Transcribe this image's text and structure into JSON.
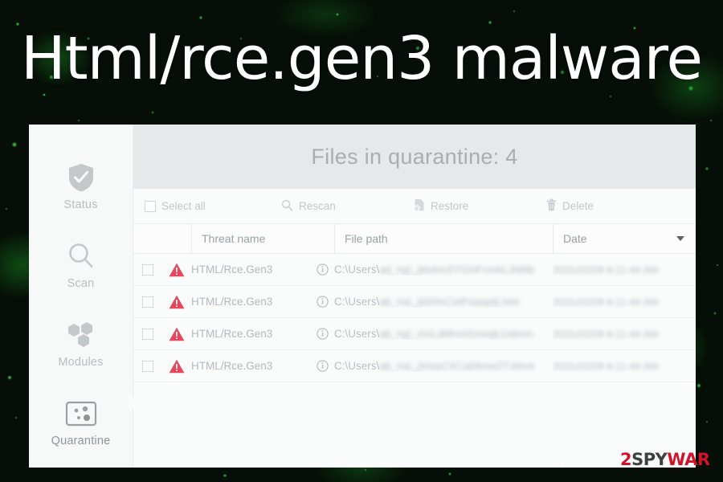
{
  "page": {
    "title": "Html/rce.gen3 malware"
  },
  "watermark": {
    "part1": "2",
    "part2": "SPY",
    "part3": "WAR"
  },
  "sidebar": {
    "items": [
      {
        "label": "Status",
        "icon": "shield-check-icon",
        "active": false
      },
      {
        "label": "Scan",
        "icon": "magnifier-icon",
        "active": false
      },
      {
        "label": "Modules",
        "icon": "hexagons-icon",
        "active": false
      },
      {
        "label": "Quarantine",
        "icon": "quarantine-box-icon",
        "active": true
      }
    ]
  },
  "header": {
    "title": "Files in quarantine: 4"
  },
  "toolbar": {
    "select_all": "Select all",
    "rescan": "Rescan",
    "restore": "Restore",
    "delete": "Delete"
  },
  "table": {
    "columns": [
      "",
      "Threat name",
      "File path",
      "Date"
    ],
    "rows": [
      {
        "threat": "HTML/Rce.Gen3",
        "path_prefix": "C:\\Users\\",
        "path_redacted": "ad_hgi_jkbAmXYGHFcmkLJNNb",
        "date_redacted": "2021/02/09 8:11:44 AM"
      },
      {
        "threat": "HTML/Rce.Gen3",
        "path_prefix": "C:\\Users\\",
        "path_redacted": "ab_hai_jbDfmCidPvjaajdj.htm",
        "date_redacted": "2021/02/09 8:11:44 AM"
      },
      {
        "threat": "HTML/Rce.Gen3",
        "path_prefix": "C:\\Users\\",
        "path_redacted": "ab_hgi_mxLdMhmGnwqkJJdmm",
        "date_redacted": "2021/02/09 8:11:44 AM"
      },
      {
        "threat": "HTML/Rce.Gen3",
        "path_prefix": "C:\\Users\\",
        "path_redacted": "ab_hai_jiHxaCXCaDbnwZTJdnm",
        "date_redacted": "2021/02/09 8:11:44 AM"
      }
    ]
  },
  "colors": {
    "threat_red": "#e8455a",
    "panel_header_bg": "#e6e9ea",
    "watermark_red": "#d3122a"
  }
}
